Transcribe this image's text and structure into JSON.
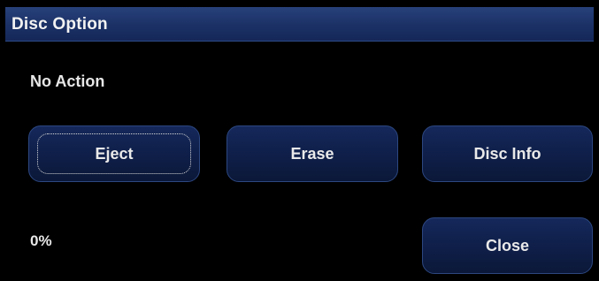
{
  "dialog": {
    "title": "Disc Option",
    "status": "No Action",
    "progress": "0%"
  },
  "buttons": {
    "eject": "Eject",
    "erase": "Erase",
    "disc_info": "Disc Info",
    "close": "Close"
  },
  "colors": {
    "titlebar": "#1b3166",
    "button_fill": "#0f1f4a",
    "button_border": "#2c4780",
    "background": "#000000",
    "text": "#e9e9e9"
  }
}
